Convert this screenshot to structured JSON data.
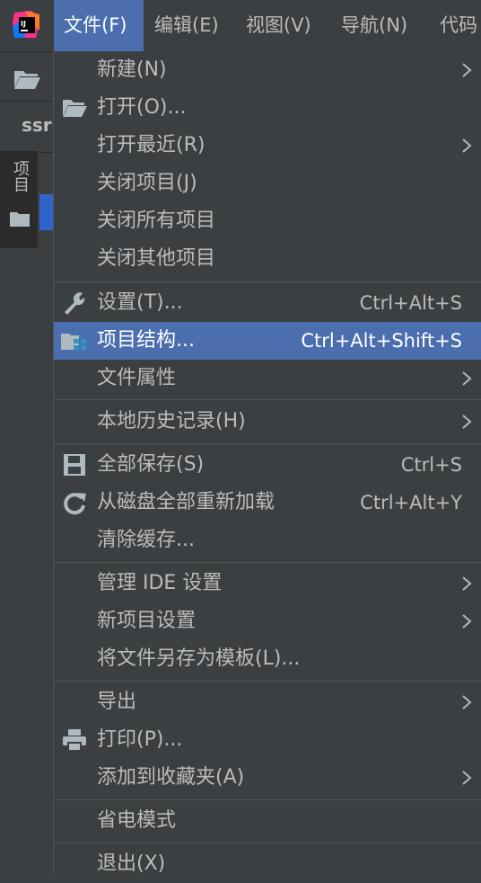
{
  "menubar": {
    "app_icon": "intellij-logo-icon",
    "items": [
      {
        "label": "文件(F)"
      },
      {
        "label": "编辑(E)"
      },
      {
        "label": "视图(V)"
      },
      {
        "label": "导航(N)"
      },
      {
        "label": "代码"
      }
    ]
  },
  "toolbar": {
    "open_icon": "folder-open-icon"
  },
  "tab_strip": {
    "label": "ssr"
  },
  "side_tool": {
    "label": "项目",
    "icon": "folder-icon"
  },
  "file_menu": {
    "items": [
      {
        "label": "新建(N)",
        "submenu": true
      },
      {
        "label": "打开(O)...",
        "icon": "folder-open-icon"
      },
      {
        "label": "打开最近(R)",
        "submenu": true
      },
      {
        "label": "关闭项目(J)"
      },
      {
        "label": "关闭所有项目"
      },
      {
        "label": "关闭其他项目"
      },
      {
        "label": "设置(T)...",
        "icon": "wrench-icon",
        "shortcut": "Ctrl+Alt+S"
      },
      {
        "label": "项目结构...",
        "icon": "project-structure-icon",
        "shortcut": "Ctrl+Alt+Shift+S",
        "highlighted": true
      },
      {
        "label": "文件属性",
        "submenu": true
      },
      {
        "label": "本地历史记录(H)",
        "submenu": true
      },
      {
        "label": "全部保存(S)",
        "icon": "save-icon",
        "shortcut": "Ctrl+S"
      },
      {
        "label": "从磁盘全部重新加载",
        "icon": "reload-icon",
        "shortcut": "Ctrl+Alt+Y"
      },
      {
        "label": "清除缓存..."
      },
      {
        "label": "管理 IDE 设置",
        "submenu": true
      },
      {
        "label": "新项目设置",
        "submenu": true
      },
      {
        "label": "将文件另存为模板(L)..."
      },
      {
        "label": "导出",
        "submenu": true
      },
      {
        "label": "打印(P)...",
        "icon": "printer-icon"
      },
      {
        "label": "添加到收藏夹(A)",
        "submenu": true
      },
      {
        "label": "省电模式"
      },
      {
        "label": "退出(X)"
      }
    ]
  },
  "colors": {
    "menu_bg": "#3c3f41",
    "highlight": "#4b6eaf",
    "text": "#bbbbbb",
    "separator": "#555555"
  }
}
